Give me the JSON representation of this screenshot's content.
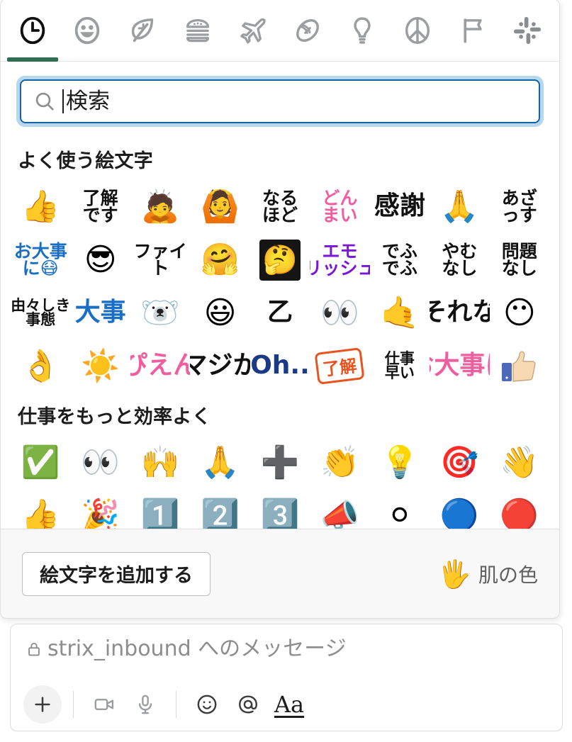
{
  "picker": {
    "tabs": [
      {
        "name": "recent",
        "icon": "clock-icon",
        "active": true
      },
      {
        "name": "smileys",
        "icon": "smiley-icon",
        "active": false
      },
      {
        "name": "nature",
        "icon": "leaf-icon",
        "active": false
      },
      {
        "name": "food",
        "icon": "burger-icon",
        "active": false
      },
      {
        "name": "travel",
        "icon": "airplane-icon",
        "active": false
      },
      {
        "name": "activity",
        "icon": "football-icon",
        "active": false
      },
      {
        "name": "objects",
        "icon": "lightbulb-icon",
        "active": false
      },
      {
        "name": "symbols",
        "icon": "peace-icon",
        "active": false
      },
      {
        "name": "flags",
        "icon": "flag-icon",
        "active": false
      },
      {
        "name": "slack",
        "icon": "slack-logo-icon",
        "active": false
      }
    ],
    "search": {
      "placeholder": "検索",
      "value": "",
      "icon": "search-icon"
    },
    "sections": [
      {
        "title": "よく使う絵文字",
        "emojis": [
          {
            "kind": "uni",
            "glyph": "👍",
            "name": "thumbsup"
          },
          {
            "kind": "text2",
            "line1": "了解",
            "line2": "です",
            "color": "black",
            "name": "ryoukai-desu"
          },
          {
            "kind": "uni",
            "glyph": "🙇",
            "name": "bow"
          },
          {
            "kind": "uni",
            "glyph": "🙆",
            "name": "ok-person"
          },
          {
            "kind": "text2",
            "line1": "なる",
            "line2": "ほど",
            "color": "black",
            "name": "naruhodo"
          },
          {
            "kind": "text2",
            "line1": "どん",
            "line2": "まい",
            "color": "pink",
            "name": "donmai"
          },
          {
            "kind": "text1",
            "line1": "感謝",
            "color": "black",
            "name": "kansha"
          },
          {
            "kind": "uni",
            "glyph": "🙏",
            "name": "pray"
          },
          {
            "kind": "text2",
            "line1": "あざ",
            "line2": "っす",
            "color": "black",
            "name": "azassu"
          },
          {
            "kind": "text2",
            "line1": "お大事",
            "line2": "に😷",
            "color": "blue",
            "name": "odaijini"
          },
          {
            "kind": "uni",
            "glyph": "😎",
            "name": "sunglasses"
          },
          {
            "kind": "text2",
            "line1": "ファイ",
            "line2": "ト",
            "color": "black",
            "name": "fight"
          },
          {
            "kind": "uni",
            "glyph": "🤗",
            "name": "hugging-face"
          },
          {
            "kind": "chip",
            "glyph": "🤔",
            "color": "dark",
            "name": "thinking-face-dark"
          },
          {
            "kind": "text2",
            "line1": "エモ",
            "line2": "リッシュ",
            "color": "purple",
            "name": "emorisshu"
          },
          {
            "kind": "text2",
            "line1": "でふ",
            "line2": "でふ",
            "color": "black",
            "name": "defudefu"
          },
          {
            "kind": "text2",
            "line1": "やむ",
            "line2": "なし",
            "color": "black",
            "name": "yamunashi"
          },
          {
            "kind": "text2",
            "line1": "問題",
            "line2": "なし",
            "color": "black",
            "name": "mondainashi"
          },
          {
            "kind": "text2sm",
            "line1": "由々しき",
            "line2": "事態",
            "color": "black",
            "name": "yuyushiki-jitai"
          },
          {
            "kind": "text1",
            "line1": "大事",
            "color": "blue",
            "name": "daiji"
          },
          {
            "kind": "uni",
            "glyph": "🐻‍❄",
            "name": "white-bear-sticker"
          },
          {
            "kind": "uni",
            "glyph": "😃",
            "name": "awesome-face"
          },
          {
            "kind": "text1",
            "line1": "乙",
            "color": "black",
            "name": "otsu"
          },
          {
            "kind": "uni",
            "glyph": "👀",
            "name": "eyes"
          },
          {
            "kind": "uni",
            "glyph": "🤙",
            "name": "call-me-hand"
          },
          {
            "kind": "text1",
            "line1": "それな",
            "color": "black",
            "name": "sorena"
          },
          {
            "kind": "uni",
            "glyph": "😶",
            "name": "sparkle-mochi-sticker"
          },
          {
            "kind": "uni",
            "glyph": "👌",
            "name": "ok-hand"
          },
          {
            "kind": "uni",
            "glyph": "☀️",
            "name": "sun"
          },
          {
            "kind": "text1",
            "line1": "ぴえん",
            "color": "pink",
            "name": "pien"
          },
          {
            "kind": "text1",
            "line1": "マジか",
            "color": "black",
            "name": "majika"
          },
          {
            "kind": "text1",
            "line1": "Oh..",
            "color": "navy",
            "name": "oh"
          },
          {
            "kind": "stamp",
            "line1": "了解",
            "color": "orange",
            "name": "ryoukai-stamp"
          },
          {
            "kind": "text2sm",
            "line1": "仕事",
            "line2": "早い",
            "color": "black",
            "name": "shigoto-hayai"
          },
          {
            "kind": "text1",
            "line1": "お大事に",
            "color": "pink",
            "name": "odaijini-pink"
          },
          {
            "kind": "fbthumb",
            "name": "facebook-like"
          }
        ]
      },
      {
        "title": "仕事をもっと効率よく",
        "emojis": [
          {
            "kind": "uni",
            "glyph": "✅",
            "name": "white-check-mark"
          },
          {
            "kind": "uni",
            "glyph": "👀",
            "name": "eyes"
          },
          {
            "kind": "uni",
            "glyph": "🙌",
            "name": "raised-hands"
          },
          {
            "kind": "uni",
            "glyph": "🙏",
            "name": "pray"
          },
          {
            "kind": "uni",
            "glyph": "➕",
            "name": "heavy-plus-sign"
          },
          {
            "kind": "uni",
            "glyph": "👏",
            "name": "clap"
          },
          {
            "kind": "uni",
            "glyph": "💡",
            "name": "bulb"
          },
          {
            "kind": "uni",
            "glyph": "🎯",
            "name": "dart"
          },
          {
            "kind": "uni",
            "glyph": "👋",
            "name": "wave"
          },
          {
            "kind": "uni",
            "glyph": "👍",
            "name": "thumbsup"
          },
          {
            "kind": "uni",
            "glyph": "🎉",
            "name": "tada"
          },
          {
            "kind": "uni",
            "glyph": "1️⃣",
            "name": "one"
          },
          {
            "kind": "uni",
            "glyph": "2️⃣",
            "name": "two"
          },
          {
            "kind": "uni",
            "glyph": "3️⃣",
            "name": "three"
          },
          {
            "kind": "uni",
            "glyph": "📣",
            "name": "mega"
          },
          {
            "kind": "uni",
            "glyph": "⚪",
            "name": "white-circle"
          },
          {
            "kind": "uni",
            "glyph": "🔵",
            "name": "large-blue-circle"
          },
          {
            "kind": "uni",
            "glyph": "🔴",
            "name": "red-circle"
          }
        ]
      }
    ],
    "footer": {
      "add_emoji_label": "絵文字を追加する",
      "skin_tone_label": "肌の色",
      "skin_tone_icon": "🖐"
    }
  },
  "composer": {
    "lock_icon": "🔒",
    "placeholder": "strix_inbound へのメッセージ",
    "channel": "strix_inbound",
    "toolbar": [
      {
        "name": "add-attachment-button",
        "icon": "plus-icon"
      },
      {
        "name": "toolbar-divider-1",
        "icon": "divider"
      },
      {
        "name": "video-clip-button",
        "icon": "video-icon"
      },
      {
        "name": "audio-clip-button",
        "icon": "microphone-icon"
      },
      {
        "name": "toolbar-divider-2",
        "icon": "divider"
      },
      {
        "name": "emoji-button",
        "icon": "smiley-icon"
      },
      {
        "name": "mention-button",
        "icon": "at-icon"
      },
      {
        "name": "formatting-button",
        "icon": "aa-icon",
        "label": "Aa"
      }
    ]
  },
  "colors": {
    "active_tab_underline": "#2e6e4f",
    "search_border": "#1264a3",
    "search_focus_ring": "#b7d7ef",
    "text_primary": "#1d1c1d",
    "text_muted": "#616061"
  }
}
